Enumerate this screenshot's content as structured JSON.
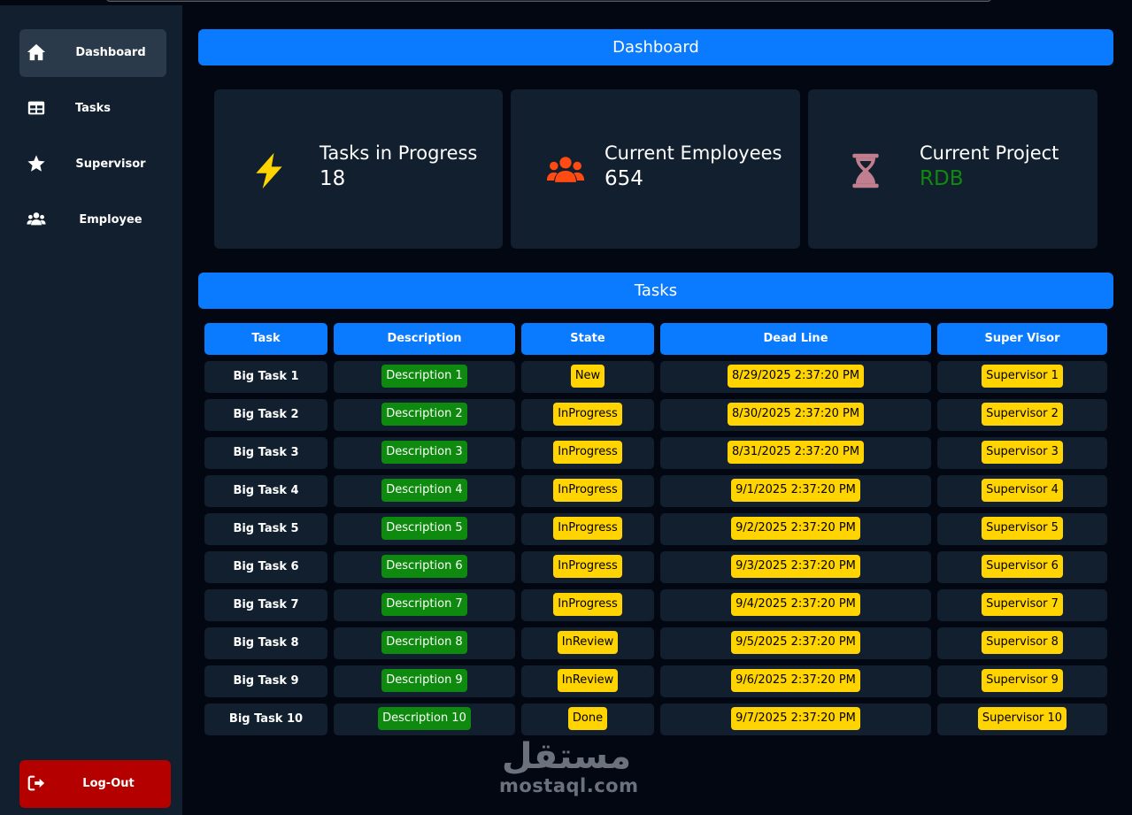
{
  "sidebar": {
    "items": [
      {
        "label": "Dashboard",
        "icon": "home-icon",
        "active": true
      },
      {
        "label": "Tasks",
        "icon": "table-icon",
        "active": false
      },
      {
        "label": "Supervisor",
        "icon": "star-icon",
        "active": false
      },
      {
        "label": "Employee",
        "icon": "users-icon",
        "active": false
      }
    ],
    "logout": {
      "label": "Log-Out",
      "icon": "sign-out-icon"
    }
  },
  "header": {
    "title": "Dashboard"
  },
  "stats": [
    {
      "title": "Tasks in Progress",
      "value": "18",
      "icon": "bolt-icon",
      "icon_color": "#ffd400",
      "value_color": "#ffffff"
    },
    {
      "title": "Current Employees",
      "value": "654",
      "icon": "users-icon",
      "icon_color": "#ff4a12",
      "value_color": "#ffffff"
    },
    {
      "title": "Current Project",
      "value": "RDB",
      "icon": "hourglass-icon",
      "icon_color": "#c07f8f",
      "value_color": "#0e8a0e"
    }
  ],
  "tasks_section": {
    "title": "Tasks",
    "columns": [
      "Task",
      "Description",
      "State",
      "Dead Line",
      "Super Visor"
    ],
    "rows": [
      {
        "task": "Big Task 1",
        "description": "Description 1",
        "state": "New",
        "deadline": "8/29/2025 2:37:20 PM",
        "supervisor": "Supervisor 1"
      },
      {
        "task": "Big Task 2",
        "description": "Description 2",
        "state": "InProgress",
        "deadline": "8/30/2025 2:37:20 PM",
        "supervisor": "Supervisor 2"
      },
      {
        "task": "Big Task 3",
        "description": "Description 3",
        "state": "InProgress",
        "deadline": "8/31/2025 2:37:20 PM",
        "supervisor": "Supervisor 3"
      },
      {
        "task": "Big Task 4",
        "description": "Description 4",
        "state": "InProgress",
        "deadline": "9/1/2025 2:37:20 PM",
        "supervisor": "Supervisor 4"
      },
      {
        "task": "Big Task 5",
        "description": "Description 5",
        "state": "InProgress",
        "deadline": "9/2/2025 2:37:20 PM",
        "supervisor": "Supervisor 5"
      },
      {
        "task": "Big Task 6",
        "description": "Description 6",
        "state": "InProgress",
        "deadline": "9/3/2025 2:37:20 PM",
        "supervisor": "Supervisor 6"
      },
      {
        "task": "Big Task 7",
        "description": "Description 7",
        "state": "InProgress",
        "deadline": "9/4/2025 2:37:20 PM",
        "supervisor": "Supervisor 7"
      },
      {
        "task": "Big Task 8",
        "description": "Description 8",
        "state": "InReview",
        "deadline": "9/5/2025 2:37:20 PM",
        "supervisor": "Supervisor 8"
      },
      {
        "task": "Big Task 9",
        "description": "Description 9",
        "state": "InReview",
        "deadline": "9/6/2025 2:37:20 PM",
        "supervisor": "Supervisor 9"
      },
      {
        "task": "Big Task 10",
        "description": "Description 10",
        "state": "Done",
        "deadline": "9/7/2025 2:37:20 PM",
        "supervisor": "Supervisor 10"
      }
    ]
  },
  "watermark": {
    "arabic": "مستقل",
    "text": "mostaql.com"
  }
}
